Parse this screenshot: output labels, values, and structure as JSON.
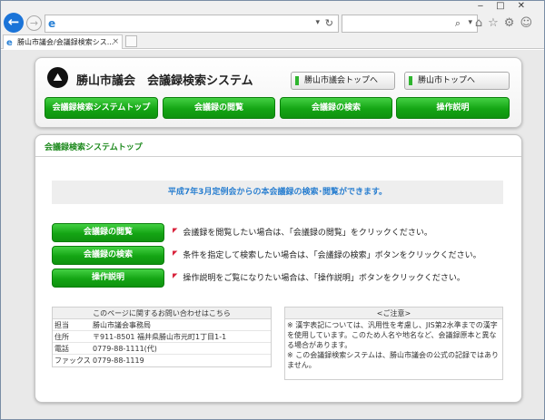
{
  "browser": {
    "address_text": "",
    "search_text": "",
    "tab_title": "勝山市議会/会議録検索シス...",
    "tab_close": "×"
  },
  "header": {
    "logo_symbol": "⛰",
    "site_title": "勝山市議会　会議録検索システム",
    "links": [
      {
        "label": "勝山市議会トップへ"
      },
      {
        "label": "勝山市トップへ"
      }
    ],
    "nav": [
      {
        "label": "会議録検索システムトップ"
      },
      {
        "label": "会議録の閲覧"
      },
      {
        "label": "会議録の検索"
      },
      {
        "label": "操作説明"
      }
    ]
  },
  "main": {
    "section_title": "会議録検索システムトップ",
    "notice": "平成7年3月定例会からの本会議録の検索･閲覧ができます。",
    "actions": [
      {
        "button": "会議録の閲覧",
        "desc": "会議録を閲覧したい場合は、「会議録の閲覧」をクリックください。"
      },
      {
        "button": "会議録の検索",
        "desc": "条件を指定して検索したい場合は、「会議録の検索」ボタンをクリックください。"
      },
      {
        "button": "操作説明",
        "desc": "操作説明をご覧になりたい場合は、「操作説明」ボタンをクリックください。"
      }
    ],
    "contact": {
      "title": "このページに関するお問い合わせはこちら",
      "rows": [
        {
          "key": "担当",
          "value": "勝山市議会事務局"
        },
        {
          "key": "住所",
          "value": "〒911-8501 福井県勝山市元町1丁目1-1"
        },
        {
          "key": "電話",
          "value": "0779-88-1111(代)"
        },
        {
          "key": "ファックス",
          "value": "0779-88-1119"
        }
      ]
    },
    "caution": {
      "title": "<ご注意>",
      "lines": [
        "※ 漢字表記については、汎用性を考慮し、JIS第2水準までの漢字を使用しています。このため人名や地名など、会議録原本と異なる場合があります。",
        "※ この会議録検索システムは、勝山市議会の公式の記録ではありません。"
      ]
    }
  },
  "colors": {
    "nav_green": "#14a514",
    "title_green": "#1e8a1e",
    "notice_blue": "#2a7fd0",
    "marker_red": "#d8213a"
  }
}
